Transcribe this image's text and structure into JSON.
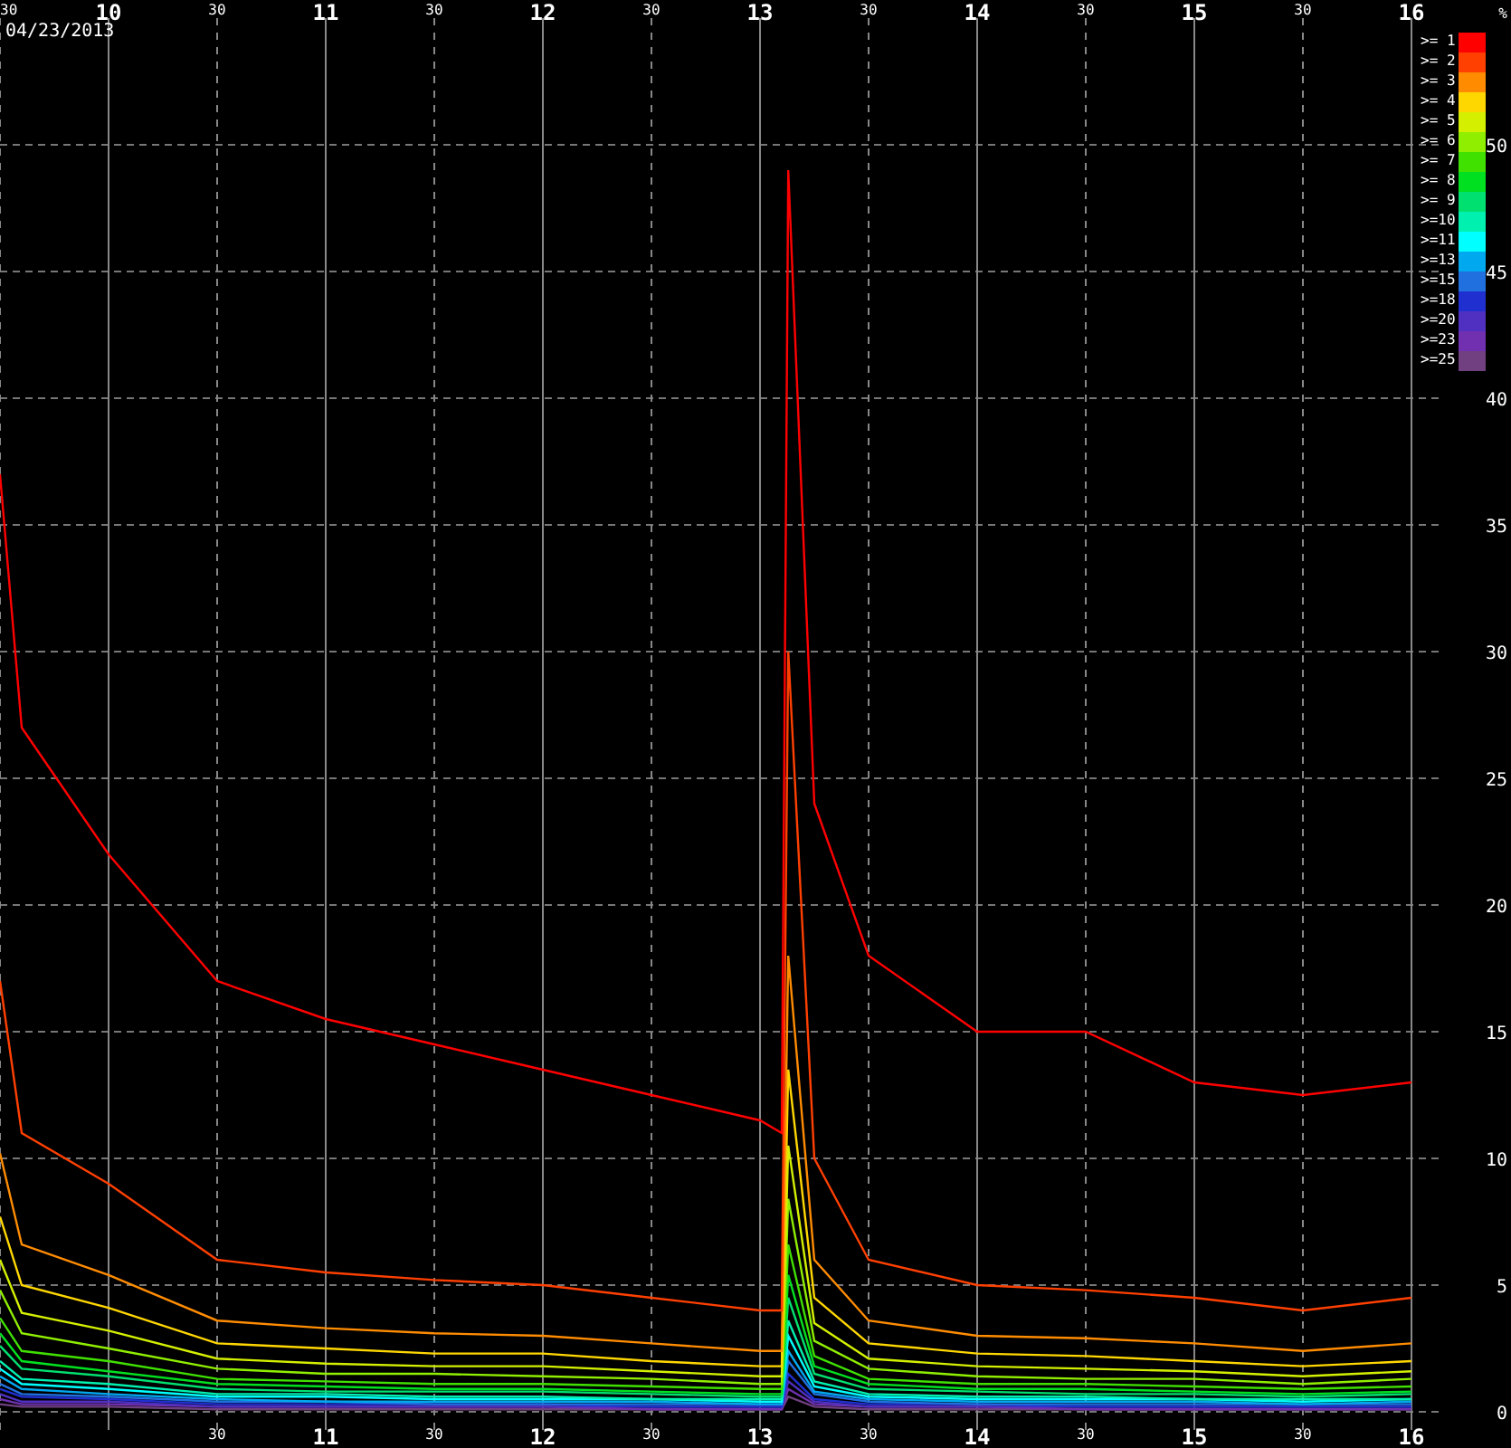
{
  "chart": {
    "date": "04/23/2013",
    "unit": "%",
    "chart_data": {
      "type": "line",
      "xlim": [
        9.5,
        16
      ],
      "ylim": [
        0,
        55
      ],
      "x": [
        9.5,
        9.6,
        10,
        10.5,
        11,
        11.5,
        12,
        12.5,
        13,
        13.1,
        13.13,
        13.25,
        13.5,
        14,
        14.5,
        15,
        15.5,
        16
      ],
      "xticks": [
        10,
        11,
        12,
        13,
        14,
        15,
        16
      ],
      "grid": true,
      "legend": true,
      "yticks": [
        0,
        5,
        10,
        15,
        20,
        25,
        30,
        35,
        40,
        45,
        50
      ],
      "series": [
        {
          "name": ">= 1",
          "color": "#ff0000",
          "values": [
            37,
            27,
            22,
            17,
            15.5,
            14.5,
            13.5,
            12.5,
            11.5,
            11,
            49,
            24,
            18,
            15,
            15,
            13,
            12.5,
            13
          ]
        },
        {
          "name": ">= 2",
          "color": "#ff4000",
          "values": [
            17,
            11,
            9,
            6,
            5.5,
            5.2,
            5,
            4.5,
            4,
            4,
            30,
            10,
            6,
            5,
            4.8,
            4.5,
            4,
            4.5
          ]
        },
        {
          "name": ">= 3",
          "color": "#ff8c00",
          "values": [
            10.2,
            6.6,
            5.4,
            3.6,
            3.3,
            3.1,
            3,
            2.7,
            2.4,
            2.4,
            18,
            6,
            3.6,
            3,
            2.9,
            2.7,
            2.4,
            2.7
          ]
        },
        {
          "name": ">= 4",
          "color": "#ffd700",
          "values": [
            7.7,
            5,
            4.1,
            2.7,
            2.5,
            2.3,
            2.3,
            2,
            1.8,
            1.8,
            13.5,
            4.5,
            2.7,
            2.3,
            2.2,
            2,
            1.8,
            2
          ]
        },
        {
          "name": ">= 5",
          "color": "#d4f000",
          "values": [
            6,
            3.9,
            3.2,
            2.1,
            1.9,
            1.8,
            1.8,
            1.6,
            1.4,
            1.4,
            10.5,
            3.5,
            2.1,
            1.8,
            1.7,
            1.6,
            1.4,
            1.6
          ]
        },
        {
          "name": ">= 6",
          "color": "#90ee00",
          "values": [
            4.8,
            3.1,
            2.5,
            1.7,
            1.5,
            1.5,
            1.4,
            1.3,
            1.1,
            1.1,
            8.4,
            2.8,
            1.7,
            1.4,
            1.3,
            1.3,
            1.1,
            1.3
          ]
        },
        {
          "name": ">= 7",
          "color": "#40e000",
          "values": [
            3.7,
            2.4,
            2,
            1.3,
            1.2,
            1.1,
            1.1,
            1,
            0.9,
            0.9,
            6.6,
            2.2,
            1.3,
            1.1,
            1.1,
            1,
            0.9,
            1
          ]
        },
        {
          "name": ">= 8",
          "color": "#00e020",
          "values": [
            3.1,
            2,
            1.6,
            1.1,
            1,
            0.9,
            0.9,
            0.8,
            0.7,
            0.7,
            5.4,
            1.8,
            1.1,
            0.9,
            0.9,
            0.8,
            0.7,
            0.8
          ]
        },
        {
          "name": ">= 9",
          "color": "#00e070",
          "values": [
            2.6,
            1.7,
            1.4,
            0.9,
            0.8,
            0.8,
            0.8,
            0.7,
            0.6,
            0.6,
            4.5,
            1.5,
            0.9,
            0.8,
            0.7,
            0.7,
            0.6,
            0.7
          ]
        },
        {
          "name": ">=10",
          "color": "#00f0b0",
          "values": [
            2,
            1.3,
            1.1,
            0.7,
            0.7,
            0.6,
            0.6,
            0.5,
            0.5,
            0.5,
            3.6,
            1.2,
            0.7,
            0.6,
            0.6,
            0.5,
            0.5,
            0.5
          ]
        },
        {
          "name": ">=11",
          "color": "#00ffff",
          "values": [
            1.7,
            1.1,
            0.9,
            0.6,
            0.6,
            0.5,
            0.5,
            0.5,
            0.4,
            0.4,
            3,
            1,
            0.6,
            0.5,
            0.5,
            0.5,
            0.4,
            0.5
          ]
        },
        {
          "name": ">=13",
          "color": "#00a8f0",
          "values": [
            1.4,
            0.9,
            0.7,
            0.5,
            0.4,
            0.4,
            0.4,
            0.4,
            0.3,
            0.3,
            2.4,
            0.8,
            0.5,
            0.4,
            0.4,
            0.4,
            0.3,
            0.4
          ]
        },
        {
          "name": ">=15",
          "color": "#2070e0",
          "values": [
            1.1,
            0.7,
            0.6,
            0.4,
            0.4,
            0.3,
            0.3,
            0.3,
            0.3,
            0.3,
            2,
            0.7,
            0.4,
            0.3,
            0.3,
            0.3,
            0.3,
            0.3
          ]
        },
        {
          "name": ">=18",
          "color": "#2030d0",
          "values": [
            0.9,
            0.6,
            0.5,
            0.3,
            0.3,
            0.3,
            0.3,
            0.2,
            0.2,
            0.2,
            1.5,
            0.5,
            0.3,
            0.3,
            0.2,
            0.2,
            0.2,
            0.2
          ]
        },
        {
          "name": ">=20",
          "color": "#5030c0",
          "values": [
            0.7,
            0.4,
            0.4,
            0.2,
            0.2,
            0.2,
            0.2,
            0.2,
            0.2,
            0.2,
            1.2,
            0.4,
            0.2,
            0.2,
            0.2,
            0.2,
            0.2,
            0.2
          ]
        },
        {
          "name": ">=23",
          "color": "#7030b0",
          "values": [
            0.5,
            0.3,
            0.3,
            0.2,
            0.2,
            0.2,
            0.2,
            0.1,
            0.1,
            0.1,
            0.9,
            0.3,
            0.2,
            0.2,
            0.1,
            0.1,
            0.1,
            0.1
          ]
        },
        {
          "name": ">=25",
          "color": "#704080",
          "values": [
            0.3,
            0.2,
            0.2,
            0.1,
            0.1,
            0.1,
            0.1,
            0.1,
            0.1,
            0.1,
            0.6,
            0.2,
            0.1,
            0.1,
            0.1,
            0.1,
            0.1,
            0.1
          ]
        }
      ]
    },
    "top_minute_labels": [
      "30",
      "30",
      "30",
      "30",
      "30",
      "30",
      "30"
    ],
    "bottom_hour_labels": [
      "11",
      "12",
      "13",
      "14",
      "15",
      "16"
    ],
    "bottom_minute_labels": [
      "30",
      "30",
      "30",
      "30",
      "30",
      "30"
    ]
  }
}
